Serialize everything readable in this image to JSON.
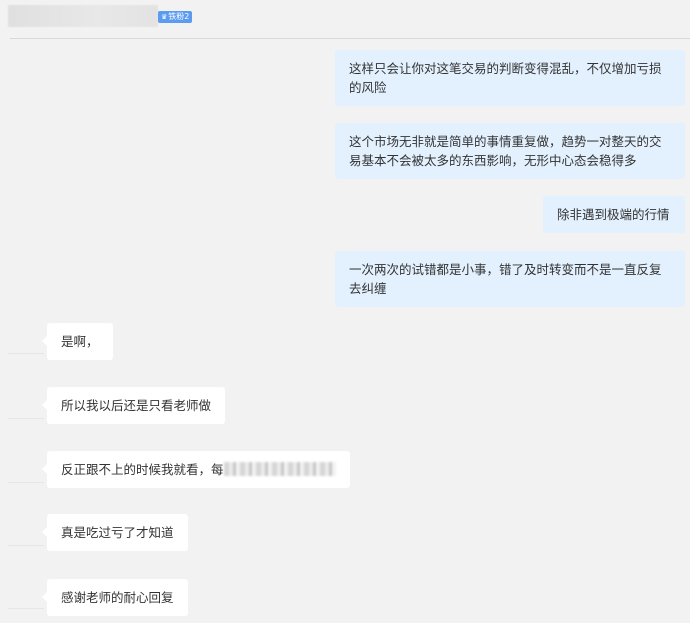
{
  "header": {
    "badge_label": "铁粉2",
    "badge_icon": "crown-icon"
  },
  "messages_right": [
    {
      "text": "这样只会让你对这笔交易的判断变得混乱，不仅增加亏损的风险"
    },
    {
      "text": "这个市场无非就是简单的事情重复做，趋势一对整天的交易基本不会被太多的东西影响，无形中心态会稳得多"
    },
    {
      "text": "除非遇到极端的行情"
    },
    {
      "text": "一次两次的试错都是小事，错了及时转变而不是一直反复去纠缠"
    }
  ],
  "messages_left": [
    {
      "text": "是啊，"
    },
    {
      "text": "所以我以后还是只看老师做"
    },
    {
      "text": "反正跟不上的时候我就看，每"
    },
    {
      "text": "真是吃过亏了才知道"
    },
    {
      "text": "感谢老师的耐心回复"
    }
  ],
  "colors": {
    "background": "#f2f2f2",
    "bubble_right": "#e3f0fd",
    "bubble_left": "#ffffff",
    "badge": "#5b9cf0"
  }
}
